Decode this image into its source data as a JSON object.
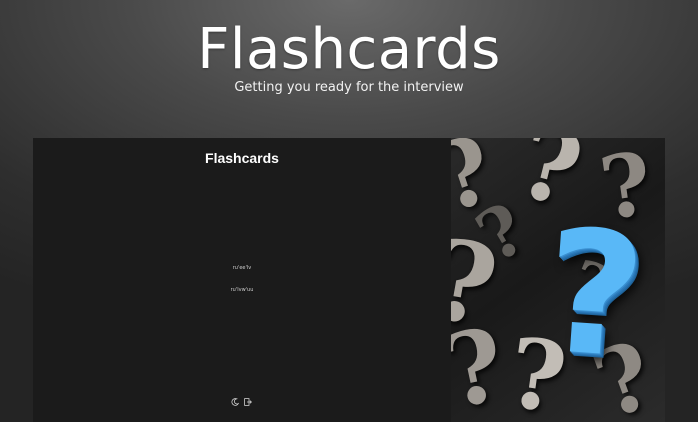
{
  "hero": {
    "title": "Flashcards",
    "subtitle": "Getting you ready for the interview"
  },
  "preview": {
    "app_title": "Flashcards",
    "links": [
      "ru'ee'lv",
      "ru'lvw'uu"
    ],
    "footer_icons": [
      "moon-icon",
      "logout-icon"
    ],
    "image_glyph": "?"
  },
  "colors": {
    "accent_question_mark": "#59b8f7",
    "app_background": "#1b1b1b"
  }
}
